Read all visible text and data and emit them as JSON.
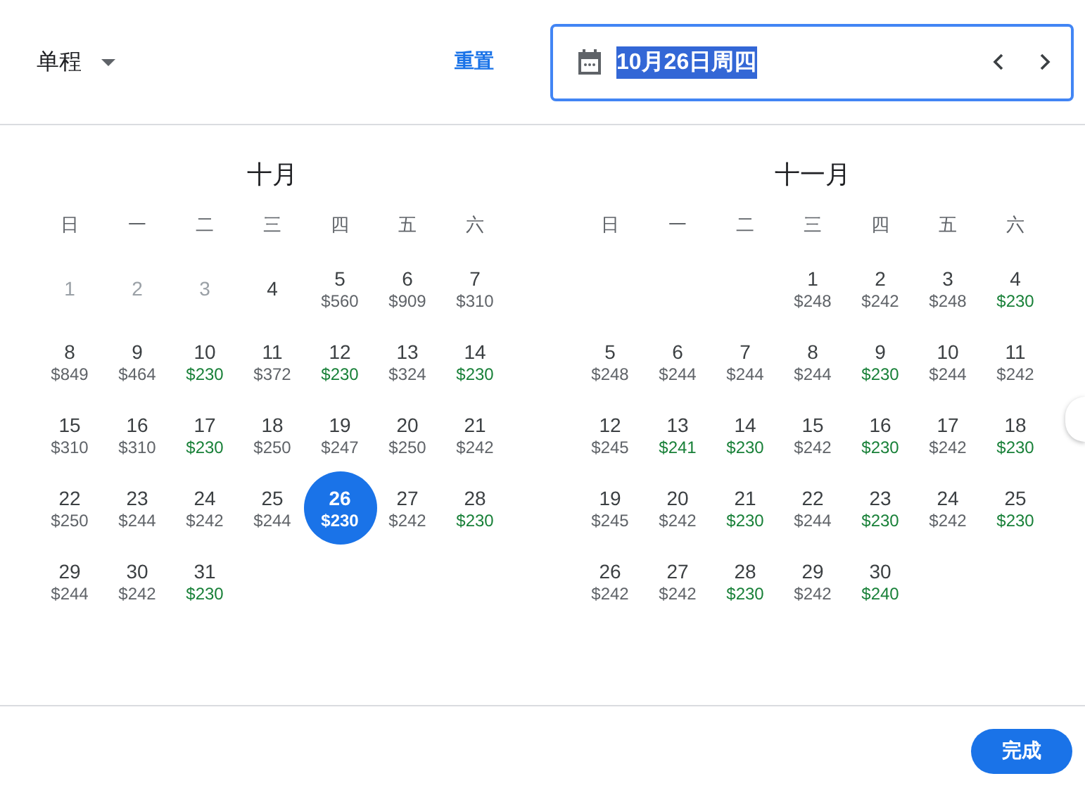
{
  "header": {
    "trip_type": "单程",
    "reset": "重置",
    "date_field": {
      "value": "10月26日周四",
      "selected_text": true
    }
  },
  "months": [
    {
      "title": "十月",
      "weekdays": [
        "日",
        "一",
        "二",
        "三",
        "四",
        "五",
        "六"
      ],
      "days": [
        {
          "kind": "day",
          "day": "1",
          "disabled": true,
          "selected": false
        },
        {
          "kind": "day",
          "day": "2",
          "disabled": true,
          "selected": false
        },
        {
          "kind": "day",
          "day": "3",
          "disabled": true,
          "selected": false
        },
        {
          "kind": "day",
          "day": "4",
          "disabled": false,
          "selected": false
        },
        {
          "kind": "day",
          "day": "5",
          "price": "$560",
          "cheap": false,
          "disabled": false,
          "selected": false
        },
        {
          "kind": "day",
          "day": "6",
          "price": "$909",
          "cheap": false,
          "disabled": false,
          "selected": false
        },
        {
          "kind": "day",
          "day": "7",
          "price": "$310",
          "cheap": false,
          "disabled": false,
          "selected": false
        },
        {
          "kind": "day",
          "day": "8",
          "price": "$849",
          "cheap": false,
          "disabled": false,
          "selected": false
        },
        {
          "kind": "day",
          "day": "9",
          "price": "$464",
          "cheap": false,
          "disabled": false,
          "selected": false
        },
        {
          "kind": "day",
          "day": "10",
          "price": "$230",
          "cheap": true,
          "disabled": false,
          "selected": false
        },
        {
          "kind": "day",
          "day": "11",
          "price": "$372",
          "cheap": false,
          "disabled": false,
          "selected": false
        },
        {
          "kind": "day",
          "day": "12",
          "price": "$230",
          "cheap": true,
          "disabled": false,
          "selected": false
        },
        {
          "kind": "day",
          "day": "13",
          "price": "$324",
          "cheap": false,
          "disabled": false,
          "selected": false
        },
        {
          "kind": "day",
          "day": "14",
          "price": "$230",
          "cheap": true,
          "disabled": false,
          "selected": false
        },
        {
          "kind": "day",
          "day": "15",
          "price": "$310",
          "cheap": false,
          "disabled": false,
          "selected": false
        },
        {
          "kind": "day",
          "day": "16",
          "price": "$310",
          "cheap": false,
          "disabled": false,
          "selected": false
        },
        {
          "kind": "day",
          "day": "17",
          "price": "$230",
          "cheap": true,
          "disabled": false,
          "selected": false
        },
        {
          "kind": "day",
          "day": "18",
          "price": "$250",
          "cheap": false,
          "disabled": false,
          "selected": false
        },
        {
          "kind": "day",
          "day": "19",
          "price": "$247",
          "cheap": false,
          "disabled": false,
          "selected": false
        },
        {
          "kind": "day",
          "day": "20",
          "price": "$250",
          "cheap": false,
          "disabled": false,
          "selected": false
        },
        {
          "kind": "day",
          "day": "21",
          "price": "$242",
          "cheap": false,
          "disabled": false,
          "selected": false
        },
        {
          "kind": "day",
          "day": "22",
          "price": "$250",
          "cheap": false,
          "disabled": false,
          "selected": false
        },
        {
          "kind": "day",
          "day": "23",
          "price": "$244",
          "cheap": false,
          "disabled": false,
          "selected": false
        },
        {
          "kind": "day",
          "day": "24",
          "price": "$242",
          "cheap": false,
          "disabled": false,
          "selected": false
        },
        {
          "kind": "day",
          "day": "25",
          "price": "$244",
          "cheap": false,
          "disabled": false,
          "selected": false
        },
        {
          "kind": "day",
          "day": "26",
          "price": "$230",
          "cheap": true,
          "disabled": false,
          "selected": true
        },
        {
          "kind": "day",
          "day": "27",
          "price": "$242",
          "cheap": false,
          "disabled": false,
          "selected": false
        },
        {
          "kind": "day",
          "day": "28",
          "price": "$230",
          "cheap": true,
          "disabled": false,
          "selected": false
        },
        {
          "kind": "day",
          "day": "29",
          "price": "$244",
          "cheap": false,
          "disabled": false,
          "selected": false
        },
        {
          "kind": "day",
          "day": "30",
          "price": "$242",
          "cheap": false,
          "disabled": false,
          "selected": false
        },
        {
          "kind": "day",
          "day": "31",
          "price": "$230",
          "cheap": true,
          "disabled": false,
          "selected": false
        }
      ]
    },
    {
      "title": "十一月",
      "weekdays": [
        "日",
        "一",
        "二",
        "三",
        "四",
        "五",
        "六"
      ],
      "days": [
        {
          "kind": "blank"
        },
        {
          "kind": "blank"
        },
        {
          "kind": "blank"
        },
        {
          "kind": "day",
          "day": "1",
          "price": "$248",
          "cheap": false,
          "disabled": false,
          "selected": false
        },
        {
          "kind": "day",
          "day": "2",
          "price": "$242",
          "cheap": false,
          "disabled": false,
          "selected": false
        },
        {
          "kind": "day",
          "day": "3",
          "price": "$248",
          "cheap": false,
          "disabled": false,
          "selected": false
        },
        {
          "kind": "day",
          "day": "4",
          "price": "$230",
          "cheap": true,
          "disabled": false,
          "selected": false
        },
        {
          "kind": "day",
          "day": "5",
          "price": "$248",
          "cheap": false,
          "disabled": false,
          "selected": false
        },
        {
          "kind": "day",
          "day": "6",
          "price": "$244",
          "cheap": false,
          "disabled": false,
          "selected": false
        },
        {
          "kind": "day",
          "day": "7",
          "price": "$244",
          "cheap": false,
          "disabled": false,
          "selected": false
        },
        {
          "kind": "day",
          "day": "8",
          "price": "$244",
          "cheap": false,
          "disabled": false,
          "selected": false
        },
        {
          "kind": "day",
          "day": "9",
          "price": "$230",
          "cheap": true,
          "disabled": false,
          "selected": false
        },
        {
          "kind": "day",
          "day": "10",
          "price": "$244",
          "cheap": false,
          "disabled": false,
          "selected": false
        },
        {
          "kind": "day",
          "day": "11",
          "price": "$242",
          "cheap": false,
          "disabled": false,
          "selected": false
        },
        {
          "kind": "day",
          "day": "12",
          "price": "$245",
          "cheap": false,
          "disabled": false,
          "selected": false
        },
        {
          "kind": "day",
          "day": "13",
          "price": "$241",
          "cheap": true,
          "disabled": false,
          "selected": false
        },
        {
          "kind": "day",
          "day": "14",
          "price": "$230",
          "cheap": true,
          "disabled": false,
          "selected": false
        },
        {
          "kind": "day",
          "day": "15",
          "price": "$242",
          "cheap": false,
          "disabled": false,
          "selected": false
        },
        {
          "kind": "day",
          "day": "16",
          "price": "$230",
          "cheap": true,
          "disabled": false,
          "selected": false
        },
        {
          "kind": "day",
          "day": "17",
          "price": "$242",
          "cheap": false,
          "disabled": false,
          "selected": false
        },
        {
          "kind": "day",
          "day": "18",
          "price": "$230",
          "cheap": true,
          "disabled": false,
          "selected": false
        },
        {
          "kind": "day",
          "day": "19",
          "price": "$245",
          "cheap": false,
          "disabled": false,
          "selected": false
        },
        {
          "kind": "day",
          "day": "20",
          "price": "$242",
          "cheap": false,
          "disabled": false,
          "selected": false
        },
        {
          "kind": "day",
          "day": "21",
          "price": "$230",
          "cheap": true,
          "disabled": false,
          "selected": false
        },
        {
          "kind": "day",
          "day": "22",
          "price": "$244",
          "cheap": false,
          "disabled": false,
          "selected": false
        },
        {
          "kind": "day",
          "day": "23",
          "price": "$230",
          "cheap": true,
          "disabled": false,
          "selected": false
        },
        {
          "kind": "day",
          "day": "24",
          "price": "$242",
          "cheap": false,
          "disabled": false,
          "selected": false
        },
        {
          "kind": "day",
          "day": "25",
          "price": "$230",
          "cheap": true,
          "disabled": false,
          "selected": false
        },
        {
          "kind": "day",
          "day": "26",
          "price": "$242",
          "cheap": false,
          "disabled": false,
          "selected": false
        },
        {
          "kind": "day",
          "day": "27",
          "price": "$242",
          "cheap": false,
          "disabled": false,
          "selected": false
        },
        {
          "kind": "day",
          "day": "28",
          "price": "$230",
          "cheap": true,
          "disabled": false,
          "selected": false
        },
        {
          "kind": "day",
          "day": "29",
          "price": "$242",
          "cheap": false,
          "disabled": false,
          "selected": false
        },
        {
          "kind": "day",
          "day": "30",
          "price": "$240",
          "cheap": true,
          "disabled": false,
          "selected": false
        }
      ]
    }
  ],
  "footer": {
    "done": "完成"
  }
}
